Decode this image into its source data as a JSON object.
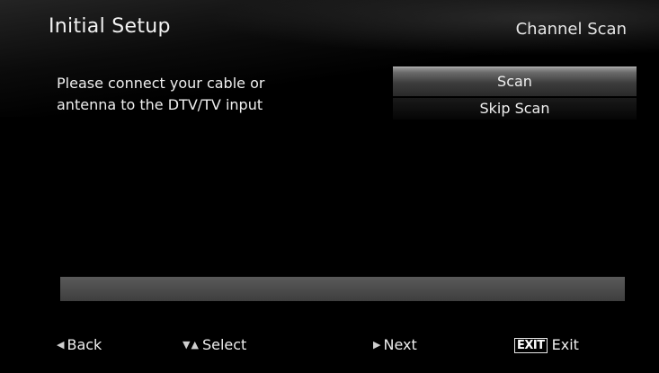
{
  "header": {
    "title": "Initial Setup",
    "subtitle": "Channel Scan"
  },
  "message": {
    "line1": "Please connect your cable or",
    "line2": "antenna to the DTV/TV input"
  },
  "menu": {
    "items": [
      {
        "label": "Scan",
        "selected": true
      },
      {
        "label": "Skip Scan",
        "selected": false
      }
    ]
  },
  "progress": {
    "value": 0
  },
  "footer": {
    "back": {
      "icon": "left-triangle-icon",
      "label": "Back"
    },
    "select": {
      "icons": [
        "down-triangle-icon",
        "up-triangle-icon"
      ],
      "label": "Select"
    },
    "next": {
      "icon": "right-triangle-icon",
      "label": "Next"
    },
    "exit": {
      "key_label": "EXIT",
      "label": "Exit"
    }
  },
  "colors": {
    "background": "#000000",
    "text": "#f0f0f0",
    "selected_highlight": "#6a6a6a",
    "progress_track": "#4a4a4a"
  }
}
